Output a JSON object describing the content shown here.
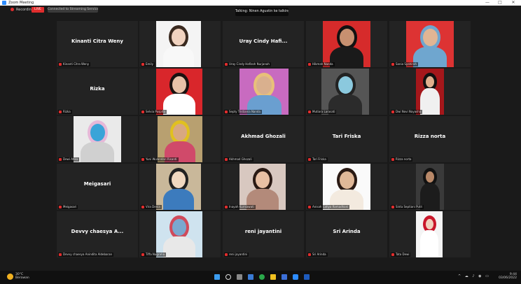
{
  "window": {
    "title": "Zoom Meeting",
    "controls": [
      "—",
      "□",
      "✕"
    ]
  },
  "top_bar": {
    "recording_label": "Recording",
    "live_label": "LIVE",
    "connection_label": "Connected to Streaming Service ▾"
  },
  "speaking_banner": "Talking: Ninen Agustin ke talking…",
  "participants": [
    {
      "display": "Kinanti Citra Weny",
      "caption": "Kinanti Citra Weny",
      "video": false
    },
    {
      "display": "",
      "caption": "Emily",
      "video": true,
      "style": "white-woman"
    },
    {
      "display": "Uray Cindy Hafi...",
      "caption": "Uray Cindy Hafizoh Nurjanah",
      "video": false
    },
    {
      "display": "",
      "caption": "Hikmah Nanda",
      "video": true,
      "style": "red-hijab-black"
    },
    {
      "display": "",
      "caption": "Sania Syahirah",
      "video": true,
      "style": "red-hijab-blue"
    },
    {
      "display": "Rizka",
      "caption": "Rizka",
      "video": false
    },
    {
      "display": "",
      "caption": "Selvia Puspita",
      "video": true,
      "style": "red-suit"
    },
    {
      "display": "",
      "caption": "Septy Tristiania Nanda",
      "video": true,
      "style": "colorful"
    },
    {
      "display": "",
      "caption": "Mutiara Larasati",
      "video": true,
      "style": "mask"
    },
    {
      "display": "",
      "caption": "Dwi Novi Nayasha",
      "video": true,
      "style": "small-hijab"
    },
    {
      "display": "",
      "caption": "Dewi Atika",
      "video": true,
      "style": "ice"
    },
    {
      "display": "",
      "caption": "Yuni Wulandari Risanti",
      "video": true,
      "style": "flowers"
    },
    {
      "display": "Akhmad Ghozali",
      "caption": "Akhmad Ghozali",
      "video": false
    },
    {
      "display": "Tari Friska",
      "caption": "Tari Friska",
      "video": false
    },
    {
      "display": "Rizza norta",
      "caption": "Rizza norta",
      "video": false
    },
    {
      "display": "Meigasari",
      "caption": "Meigasari",
      "video": false
    },
    {
      "display": "",
      "caption": "Vira Denia",
      "video": true,
      "style": "cartoon"
    },
    {
      "display": "",
      "caption": "Inayah Kurniawati",
      "video": true,
      "style": "glasses-hair"
    },
    {
      "display": "",
      "caption": "Anisah Cahya Ramadhani",
      "video": true,
      "style": "long-hair"
    },
    {
      "display": "",
      "caption": "Sinta Septiani Putri",
      "video": true,
      "style": "dark-small"
    },
    {
      "display": "Devvy chaesya A...",
      "caption": "Devvy chaesya Anindita Aldebaran",
      "video": false
    },
    {
      "display": "",
      "caption": "Tiffa Nugraha",
      "video": true,
      "style": "illustration"
    },
    {
      "display": "reni jayantini",
      "caption": "reni jayantini",
      "video": false
    },
    {
      "display": "Sri Arinda",
      "caption": "Sri Arinda",
      "video": false
    },
    {
      "display": "",
      "caption": "Tata Dewi",
      "video": true,
      "style": "red-hijab-small"
    }
  ],
  "taskbar": {
    "weather_temp": "30°C",
    "weather_desc": "Berawan",
    "time": "9:44",
    "date": "03/06/2022",
    "icons": [
      "windows",
      "search",
      "task-view",
      "widgets",
      "chrome",
      "explorer",
      "store",
      "zoom",
      "word"
    ]
  },
  "colors": {
    "accent_red": "#e02d2d",
    "tile_bg": "#232323",
    "zoom_blue": "#2d8cff"
  }
}
